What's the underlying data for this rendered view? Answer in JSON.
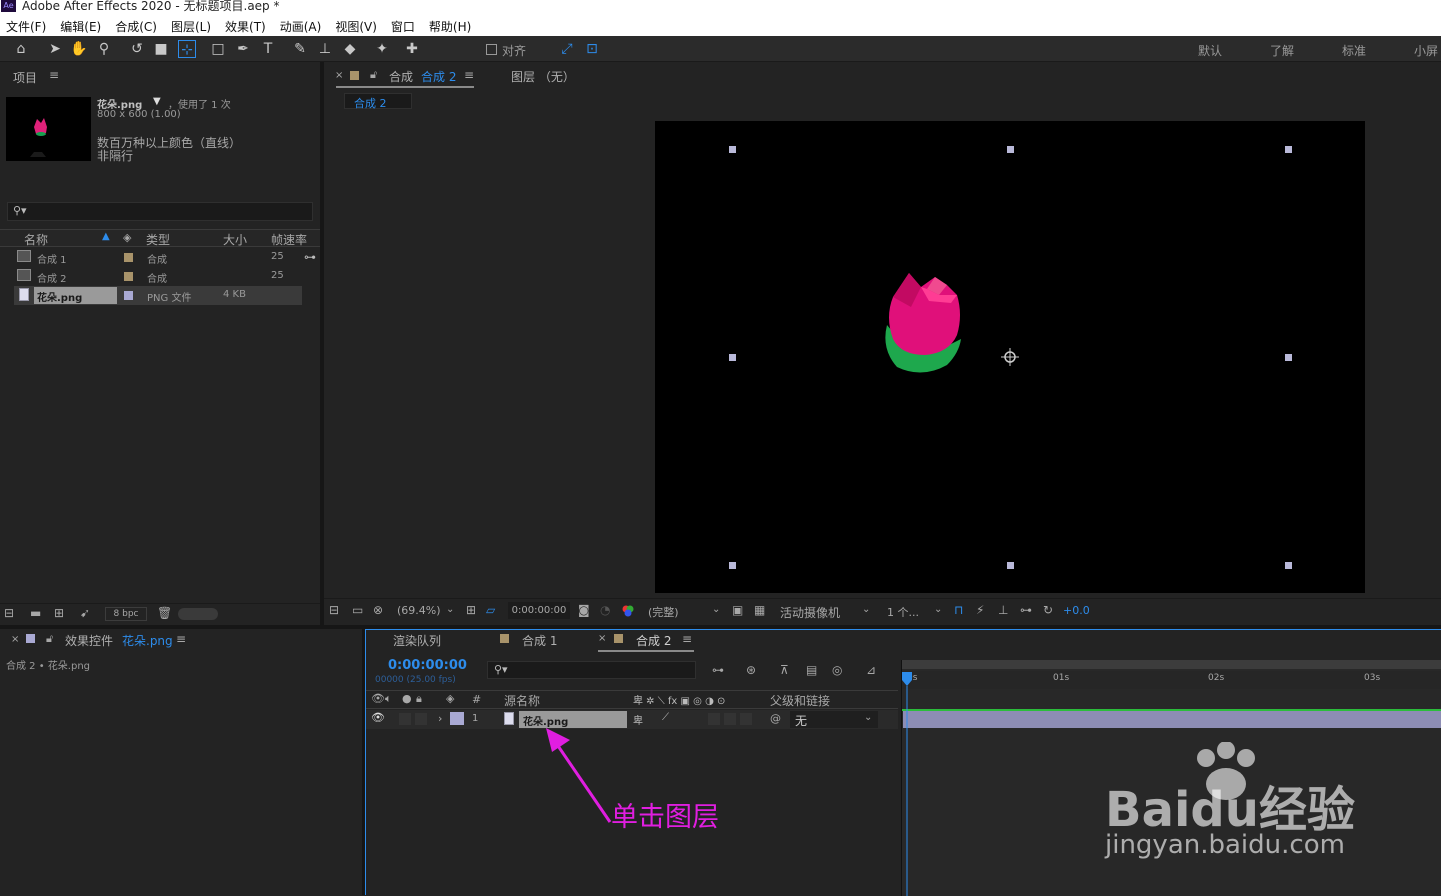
{
  "app": {
    "title": "Adobe After Effects 2020 - 无标题项目.aep *",
    "logo": "Ae"
  },
  "menu": [
    "文件(F)",
    "编辑(E)",
    "合成(C)",
    "图层(L)",
    "效果(T)",
    "动画(A)",
    "视图(V)",
    "窗口",
    "帮助(H)"
  ],
  "toolbar": {
    "align_label": "对齐",
    "workspaces": [
      "默认",
      "了解",
      "标准",
      "小屏"
    ]
  },
  "project": {
    "title": "项目",
    "preview": {
      "name": "花朵.png",
      "usage": "，使用了 1 次",
      "dims": "800 x 600 (1.00)",
      "color": "数百万种以上颜色（直线）",
      "interlace": "非隔行"
    },
    "search_placeholder": "",
    "columns": {
      "name": "名称",
      "type": "类型",
      "size": "大小",
      "fps": "帧速率"
    },
    "items": [
      {
        "name": "合成 1",
        "type": "合成",
        "size": "",
        "fps": "25",
        "color": "#a8936a"
      },
      {
        "name": "合成 2",
        "type": "合成",
        "size": "",
        "fps": "25",
        "color": "#a8936a"
      },
      {
        "name": "花朵.png",
        "type": "PNG 文件",
        "size": "4 KB",
        "fps": "",
        "color": "#a9a9d3"
      }
    ],
    "bpc": "8 bpc"
  },
  "comp": {
    "tab_label": "合成",
    "tab_name": "合成 2",
    "layer_tab": "图层 （无）",
    "subtab": "合成 2",
    "zoom": "(69.4%)",
    "time": "0:00:00:00",
    "resolution": "(完整)",
    "camera": "活动摄像机",
    "views": "1 个...",
    "exposure": "+0.0"
  },
  "effects": {
    "title": "效果控件",
    "layer": "花朵.png",
    "path": "合成 2 • 花朵.png"
  },
  "timeline": {
    "tabs": [
      "渲染队列",
      "合成 1",
      "合成 2"
    ],
    "time": "0:00:00:00",
    "frame_info": "00000 (25.00 fps)",
    "columns": {
      "num": "#",
      "source": "源名称",
      "parent": "父级和链接"
    },
    "layer": {
      "num": "1",
      "name": "花朵.png",
      "parent": "无"
    },
    "ruler": [
      "0s",
      "01s",
      "02s",
      "03s"
    ]
  },
  "annotation": {
    "text": "单击图层",
    "color": "#e01ee0"
  },
  "watermark": {
    "brand": "Baidu经验",
    "url": "jingyan.baidu.com"
  }
}
